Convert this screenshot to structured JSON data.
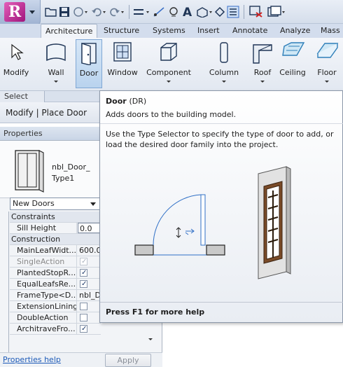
{
  "app": {
    "logo_letter": "R"
  },
  "tabs": [
    {
      "label": "Architecture",
      "active": true
    },
    {
      "label": "Structure"
    },
    {
      "label": "Systems"
    },
    {
      "label": "Insert"
    },
    {
      "label": "Annotate"
    },
    {
      "label": "Analyze"
    },
    {
      "label": "Mass"
    }
  ],
  "ribbon": {
    "modify": "Modify",
    "wall": "Wall",
    "door": "Door",
    "window": "Window",
    "component": "Component",
    "column": "Column",
    "roof": "Roof",
    "ceiling": "Ceiling",
    "floor": "Floor"
  },
  "panels": {
    "select": "Select"
  },
  "context": {
    "title": "Modify | Place Door"
  },
  "properties": {
    "title": "Properties",
    "type_name_line1": "nbl_Door_",
    "type_name_line2": "Type1",
    "type_selector": "New Doors",
    "groups": {
      "constraints": "Constraints",
      "construction": "Construction"
    },
    "rows": {
      "sill_height": {
        "label": "Sill Height",
        "value": "0.0"
      },
      "main_leaf_width": {
        "label": "MainLeafWidt...",
        "value": "600.0"
      },
      "single_action": {
        "label": "SingleAction",
        "checked": true,
        "disabled": true
      },
      "planted_stop": {
        "label": "PlantedStopR...",
        "checked": true
      },
      "equal_leafs": {
        "label": "EqualLeafsRe...",
        "checked": true
      },
      "frame_type": {
        "label": "FrameType<D...",
        "value": "nbl_D"
      },
      "extension_lining": {
        "label": "ExtensionLining",
        "checked": false
      },
      "double_action": {
        "label": "DoubleAction",
        "checked": false
      },
      "architrave": {
        "label": "ArchitraveFro...",
        "checked": true
      }
    },
    "help_link": "Properties help",
    "apply": "Apply"
  },
  "tooltip": {
    "title": "Door",
    "shortcut": "(DR)",
    "description": "Adds doors to the building model.",
    "body": "Use the Type Selector to specify the type of door to add, or load the desired door family into the project.",
    "footer": "Press F1 for more help"
  }
}
